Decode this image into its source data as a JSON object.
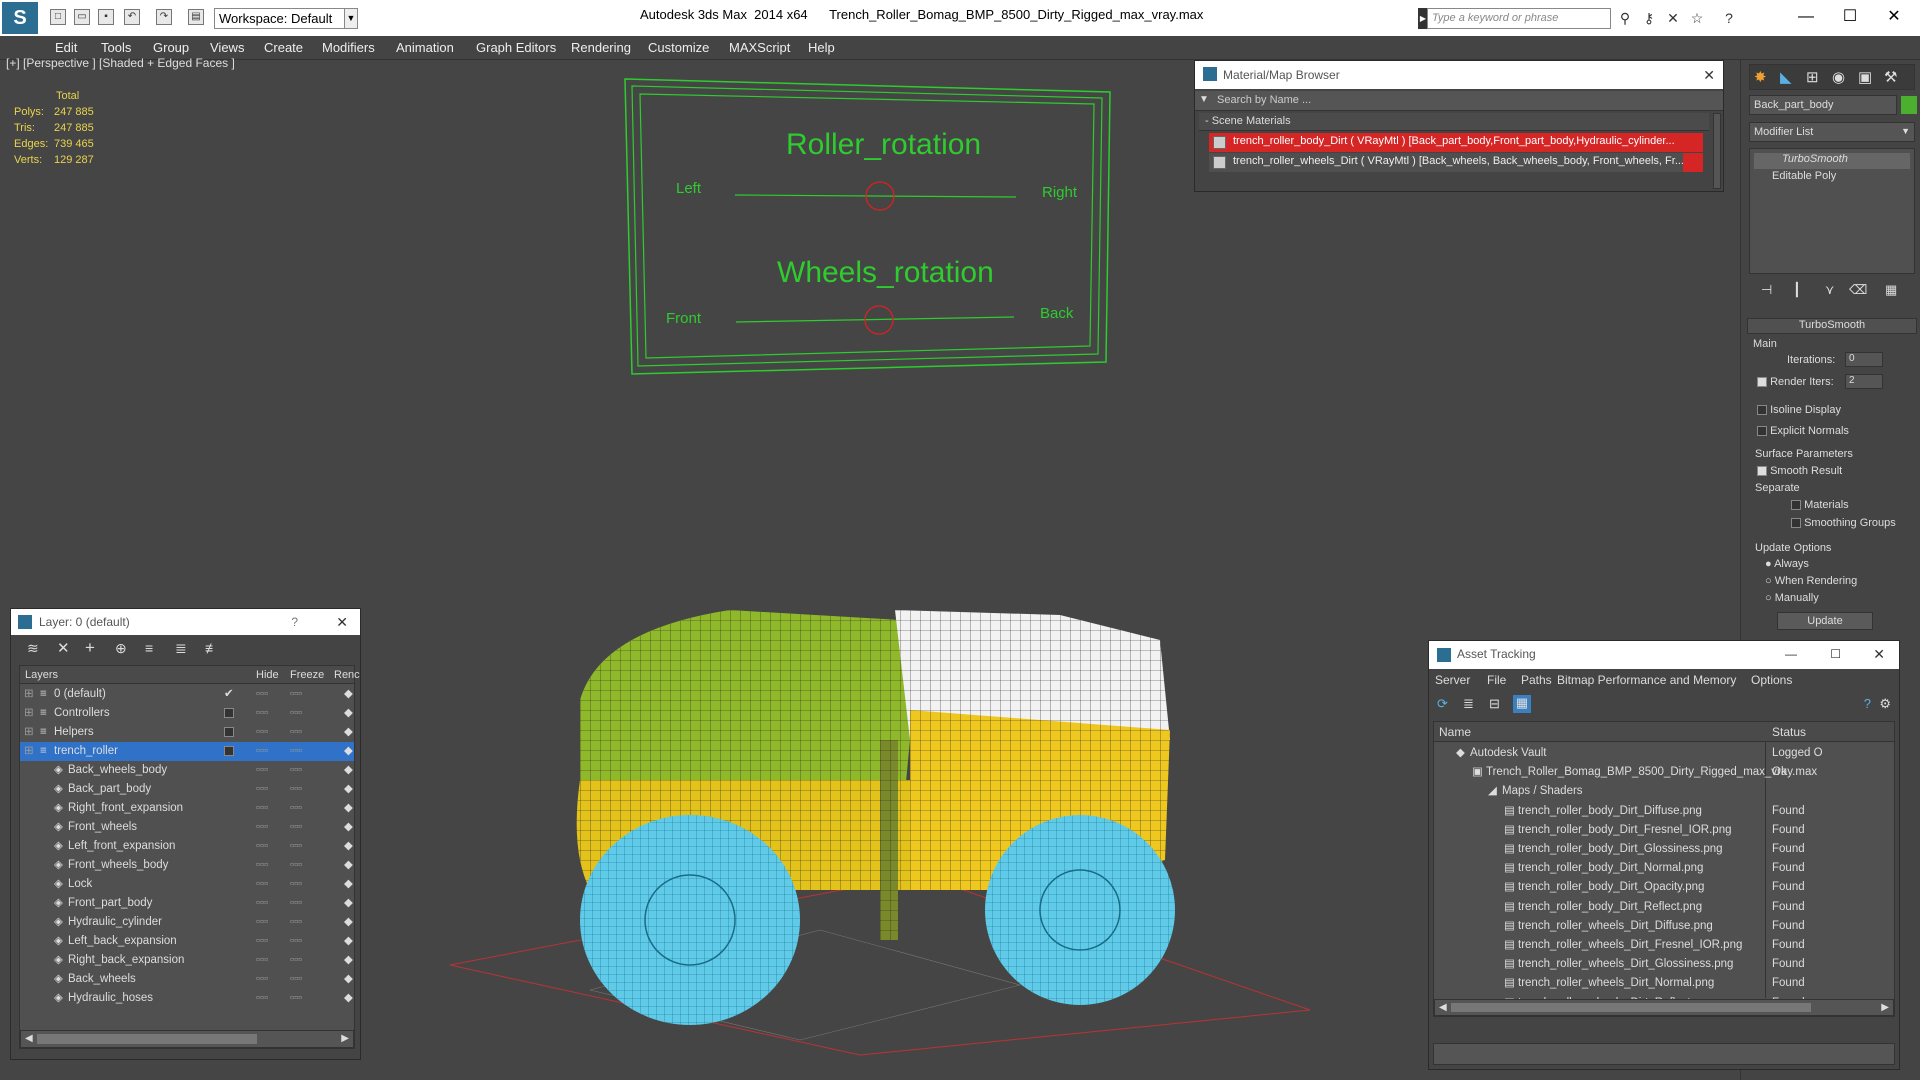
{
  "app": {
    "title": "Autodesk 3ds Max  2014 x64      Trench_Roller_Bomag_BMP_8500_Dirty_Rigged_max_vray.max",
    "workspace": "Workspace: Default",
    "search_placeholder": "Type a keyword or phrase"
  },
  "menu": [
    "Edit",
    "Tools",
    "Group",
    "Views",
    "Create",
    "Modifiers",
    "Animation",
    "Graph Editors",
    "Rendering",
    "Customize",
    "MAXScript",
    "Help"
  ],
  "viewport": {
    "label": "[+] [Perspective ] [Shaded + Edged Faces ]",
    "stats_header": "Total",
    "stats": [
      {
        "label": "Polys:",
        "value": "247 885"
      },
      {
        "label": "Tris:",
        "value": "247 885"
      },
      {
        "label": "Edges:",
        "value": "739 465"
      },
      {
        "label": "Verts:",
        "value": "129 287"
      }
    ],
    "rig": {
      "roller_title": "Roller_rotation",
      "left": "Left",
      "right": "Right",
      "wheels_title": "Wheels_rotation",
      "front": "Front",
      "back": "Back"
    }
  },
  "material_browser": {
    "title": "Material/Map Browser",
    "search": "Search by Name ...",
    "section": "- Scene Materials",
    "items": [
      "trench_roller_body_Dirt ( VRayMtl ) [Back_part_body,Front_part_body,Hydraulic_cylinder...",
      "trench_roller_wheels_Dirt ( VRayMtl ) [Back_wheels, Back_wheels_body, Front_wheels, Fr..."
    ]
  },
  "modifier_panel": {
    "object_name": "Back_part_body",
    "color": "#4caf2e",
    "modifier_list": "Modifier List",
    "stack": [
      "TurboSmooth",
      "Editable Poly"
    ],
    "rollout": "TurboSmooth",
    "main": "Main",
    "iterations_label": "Iterations:",
    "iterations_value": "0",
    "render_iters_label": "Render Iters:",
    "render_iters_value": "2",
    "isoline": "Isoline Display",
    "explicit": "Explicit Normals",
    "surface": "Surface Parameters",
    "smooth_result": "Smooth Result",
    "separate": "Separate",
    "materials": "Materials",
    "smoothing_groups": "Smoothing Groups",
    "update_options": "Update Options",
    "always": "Always",
    "when_rendering": "When Rendering",
    "manually": "Manually",
    "update_button": "Update"
  },
  "layer_explorer": {
    "title": "Layer: 0 (default)",
    "help": "?",
    "columns": {
      "layers": "Layers",
      "hide": "Hide",
      "freeze": "Freeze",
      "render": "Renc"
    },
    "layers": [
      {
        "name": "0 (default)",
        "level": 0,
        "checked": true
      },
      {
        "name": "Controllers",
        "level": 0,
        "checked": false
      },
      {
        "name": "Helpers",
        "level": 0,
        "checked": false
      },
      {
        "name": "trench_roller",
        "level": 0,
        "checked": false,
        "selected": true
      }
    ],
    "objects": [
      "Back_wheels_body",
      "Back_part_body",
      "Right_front_expansion",
      "Front_wheels",
      "Left_front_expansion",
      "Front_wheels_body",
      "Lock",
      "Front_part_body",
      "Hydraulic_cylinder",
      "Left_back_expansion",
      "Right_back_expansion",
      "Back_wheels",
      "Hydraulic_hoses"
    ]
  },
  "asset_tracking": {
    "title": "Asset Tracking",
    "menu": [
      "Server",
      "File",
      "Paths",
      "Bitmap Performance and Memory",
      "Options"
    ],
    "col_name": "Name",
    "col_status": "Status",
    "vault": {
      "name": "Autodesk Vault",
      "status": "Logged O"
    },
    "file": {
      "name": "Trench_Roller_Bomag_BMP_8500_Dirty_Rigged_max_vray.max",
      "status": "Ok"
    },
    "group": "Maps / Shaders",
    "maps": [
      {
        "name": "trench_roller_body_Dirt_Diffuse.png",
        "status": "Found"
      },
      {
        "name": "trench_roller_body_Dirt_Fresnel_IOR.png",
        "status": "Found"
      },
      {
        "name": "trench_roller_body_Dirt_Glossiness.png",
        "status": "Found"
      },
      {
        "name": "trench_roller_body_Dirt_Normal.png",
        "status": "Found"
      },
      {
        "name": "trench_roller_body_Dirt_Opacity.png",
        "status": "Found"
      },
      {
        "name": "trench_roller_body_Dirt_Reflect.png",
        "status": "Found"
      },
      {
        "name": "trench_roller_wheels_Dirt_Diffuse.png",
        "status": "Found"
      },
      {
        "name": "trench_roller_wheels_Dirt_Fresnel_IOR.png",
        "status": "Found"
      },
      {
        "name": "trench_roller_wheels_Dirt_Glossiness.png",
        "status": "Found"
      },
      {
        "name": "trench_roller_wheels_Dirt_Normal.png",
        "status": "Found"
      },
      {
        "name": "trench_roller_wheels_Dirt_Reflect.png",
        "status": "Found"
      }
    ]
  }
}
